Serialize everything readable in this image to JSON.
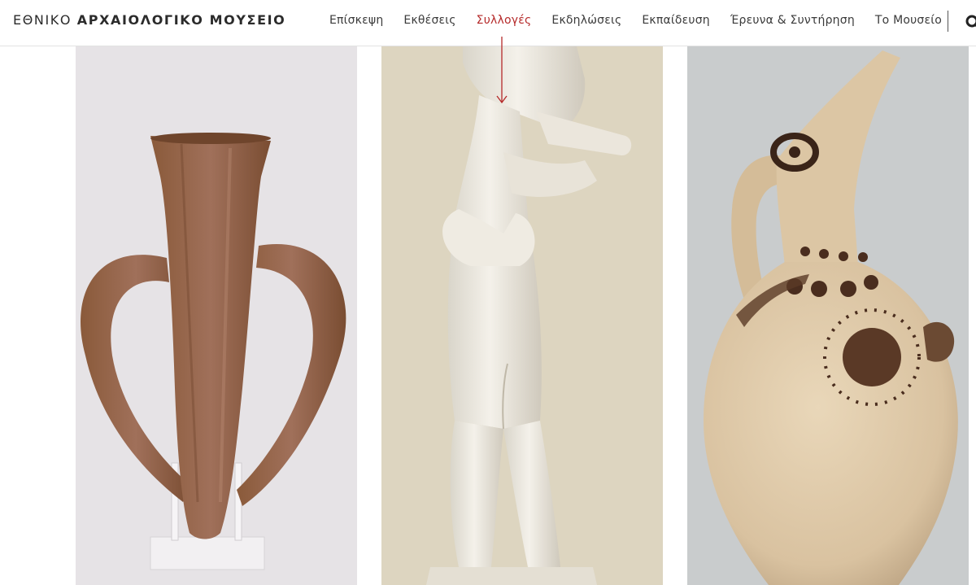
{
  "header": {
    "logo_part1": "ΕΘΝΙΚΟ",
    "logo_part2": "ΑΡΧΑΙΟΛΟΓΙΚΟ ΜΟΥΣΕΙΟ",
    "nav": [
      {
        "label": "Επίσκεψη",
        "active": false
      },
      {
        "label": "Εκθέσεις",
        "active": false
      },
      {
        "label": "Συλλογές",
        "active": true
      },
      {
        "label": "Εκδηλώσεις",
        "active": false
      },
      {
        "label": "Εκπαίδευση",
        "active": false
      },
      {
        "label": "Έρευνα & Συντήρηση",
        "active": false
      },
      {
        "label": "Το Μουσείο",
        "active": false
      }
    ],
    "search_icon": "search-icon",
    "active_color": "#b52a2a"
  },
  "gallery": {
    "panels": [
      {
        "subject": "two-handled-clay-vessel",
        "background": "#e6e3e6"
      },
      {
        "subject": "marble-figurine",
        "background": "#ddd5c0"
      },
      {
        "subject": "painted-beaked-jug",
        "background": "#c9cccd"
      }
    ]
  }
}
